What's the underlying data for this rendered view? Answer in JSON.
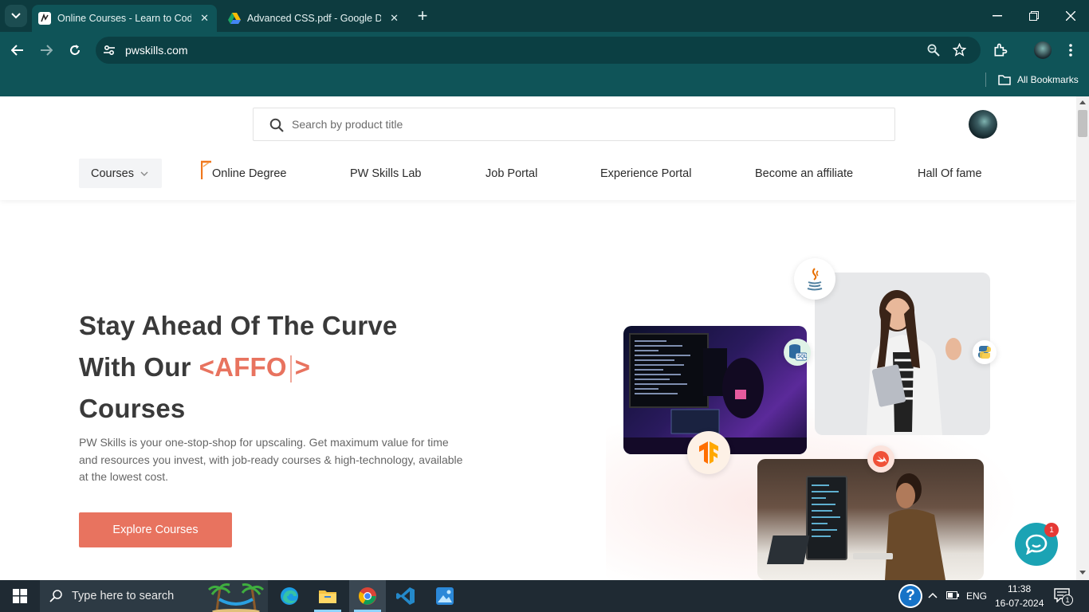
{
  "browser": {
    "tabs": [
      {
        "title": "Online Courses - Learn to Code",
        "active": true
      },
      {
        "title": "Advanced CSS.pdf - Google Drive",
        "active": false
      }
    ],
    "url": "pwskills.com",
    "bookmarks_label": "All Bookmarks"
  },
  "site": {
    "search_placeholder": "Search by product title",
    "nav": {
      "courses": "Courses",
      "online_degree": "Online Degree",
      "lab": "PW Skills Lab",
      "job_portal": "Job Portal",
      "experience_portal": "Experience Portal",
      "affiliate": "Become an affiliate",
      "hall_of_fame": "Hall Of fame"
    },
    "hero": {
      "line1": "Stay Ahead Of The Curve",
      "line2": "With Our",
      "typed_open": "<AFFO",
      "typed_close": ">",
      "line3": "Courses",
      "description": "PW Skills is your one-stop-shop for upscaling. Get maximum value for time and resources you invest, with job-ready courses & high-technology, available at the lowest cost.",
      "cta": "Explore Courses"
    },
    "badges": {
      "java": "java-icon",
      "sql": "SQL",
      "python": "python-icon",
      "tensorflow": "tensorflow-icon",
      "swift": "swift-icon"
    },
    "chat_unread": "1",
    "accent_color": "#e8735f"
  },
  "taskbar": {
    "search_placeholder": "Type here to search",
    "language": "ENG",
    "time": "11:38",
    "date": "16-07-2024",
    "notification_count": "1"
  }
}
